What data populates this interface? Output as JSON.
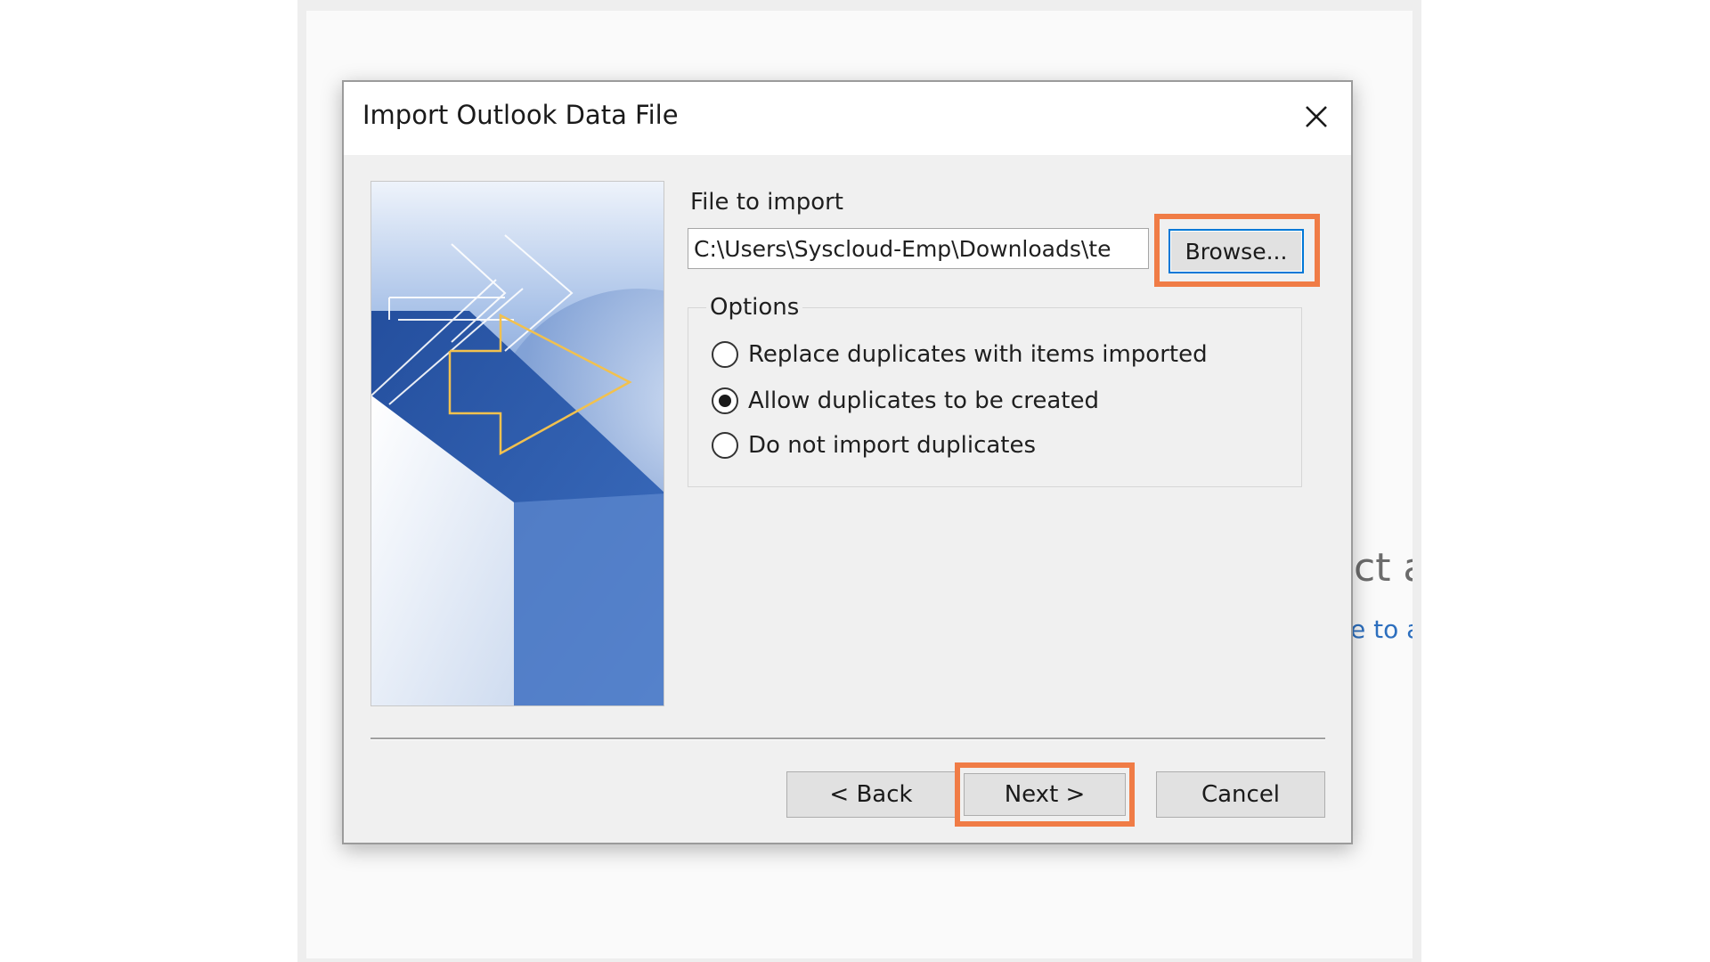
{
  "background": {
    "partial_heading": "ct a",
    "partial_link": "e to a"
  },
  "dialog": {
    "title": "Import Outlook Data File",
    "file_label": "File to import",
    "file_path": "C:\\Users\\Syscloud-Emp\\Downloads\\te",
    "browse_label": "Browse...",
    "options_label": "Options",
    "options": [
      {
        "label": "Replace duplicates with items imported",
        "selected": false
      },
      {
        "label": "Allow duplicates to be created",
        "selected": true
      },
      {
        "label": "Do not import duplicates",
        "selected": false
      }
    ],
    "back_label": "< Back",
    "next_label": "Next >",
    "cancel_label": "Cancel"
  },
  "colors": {
    "highlight": "#f07c46",
    "focus_border": "#0078d7",
    "background_link": "#2d6fbe"
  },
  "icons": {
    "close": "close-icon",
    "wizard_image": "outlook-import-arrow-graphic"
  }
}
